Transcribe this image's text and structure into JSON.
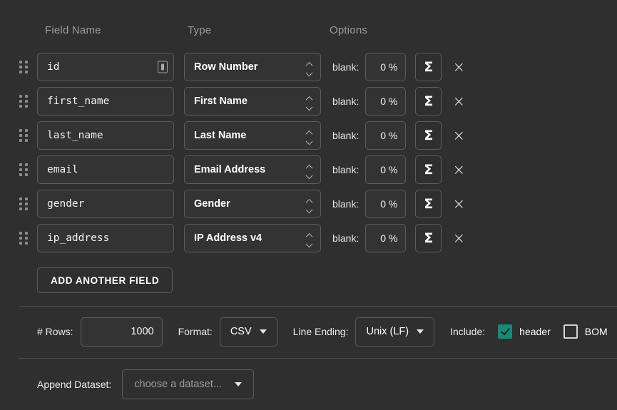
{
  "headers": {
    "field_name": "Field Name",
    "type": "Type",
    "options": "Options"
  },
  "labels": {
    "blank": "blank:",
    "sigma": "Σ",
    "delete": "×",
    "drag": "drag-handle"
  },
  "fields": [
    {
      "name": "id",
      "type": "Row Number",
      "blank": "0 %",
      "has_id_badge": true
    },
    {
      "name": "first_name",
      "type": "First Name",
      "blank": "0 %",
      "has_id_badge": false
    },
    {
      "name": "last_name",
      "type": "Last Name",
      "blank": "0 %",
      "has_id_badge": false
    },
    {
      "name": "email",
      "type": "Email Address",
      "blank": "0 %",
      "has_id_badge": false
    },
    {
      "name": "gender",
      "type": "Gender",
      "blank": "0 %",
      "has_id_badge": false
    },
    {
      "name": "ip_address",
      "type": "IP Address v4",
      "blank": "0 %",
      "has_id_badge": false
    }
  ],
  "add_field": {
    "label": "ADD ANOTHER FIELD"
  },
  "options_bar": {
    "rows_label": "# Rows:",
    "rows_value": "1000",
    "rows_placeholder": "1000",
    "format_label": "Format:",
    "format_value": "CSV",
    "line_ending_label": "Line Ending:",
    "line_ending_value": "Unix (LF)",
    "include_label": "Include:",
    "header_label": "header",
    "bom_label": "BOM"
  },
  "append": {
    "label": "Append Dataset:",
    "value": "choose a dataset..."
  },
  "colors": {
    "background": "#2f2f2f",
    "field_bg": "#333333",
    "border": "#5c5c5c",
    "accent_teal": "#178a7c",
    "header_text": "#9b9b9b",
    "text": "#ffffff"
  }
}
